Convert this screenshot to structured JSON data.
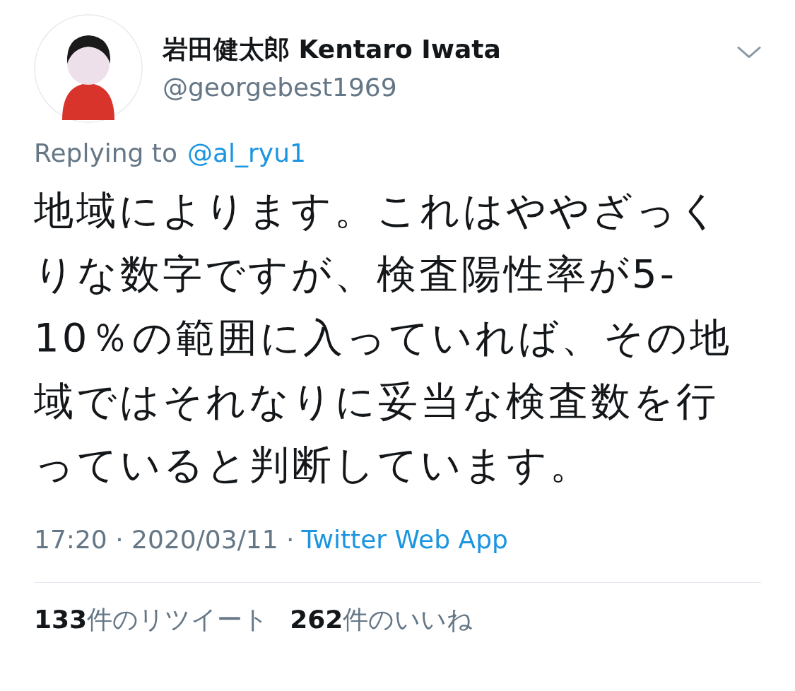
{
  "author": {
    "name": "岩田健太郎 Kentaro Iwata",
    "handle": "@georgebest1969"
  },
  "reply": {
    "prefix": "Replying to",
    "to": "@al_ryu1"
  },
  "text": "地域によります。これはややざっくりな数字ですが、検査陽性率が5-10％の範囲に入っていれば、その地域ではそれなりに妥当な検査数を行っていると判断しています。",
  "meta": {
    "posted": "17:20 · 2020/03/11 ·",
    "source": "Twitter Web App"
  },
  "stats": [
    "**133**件のリツイート",
    "**262**件のいいね"
  ]
}
